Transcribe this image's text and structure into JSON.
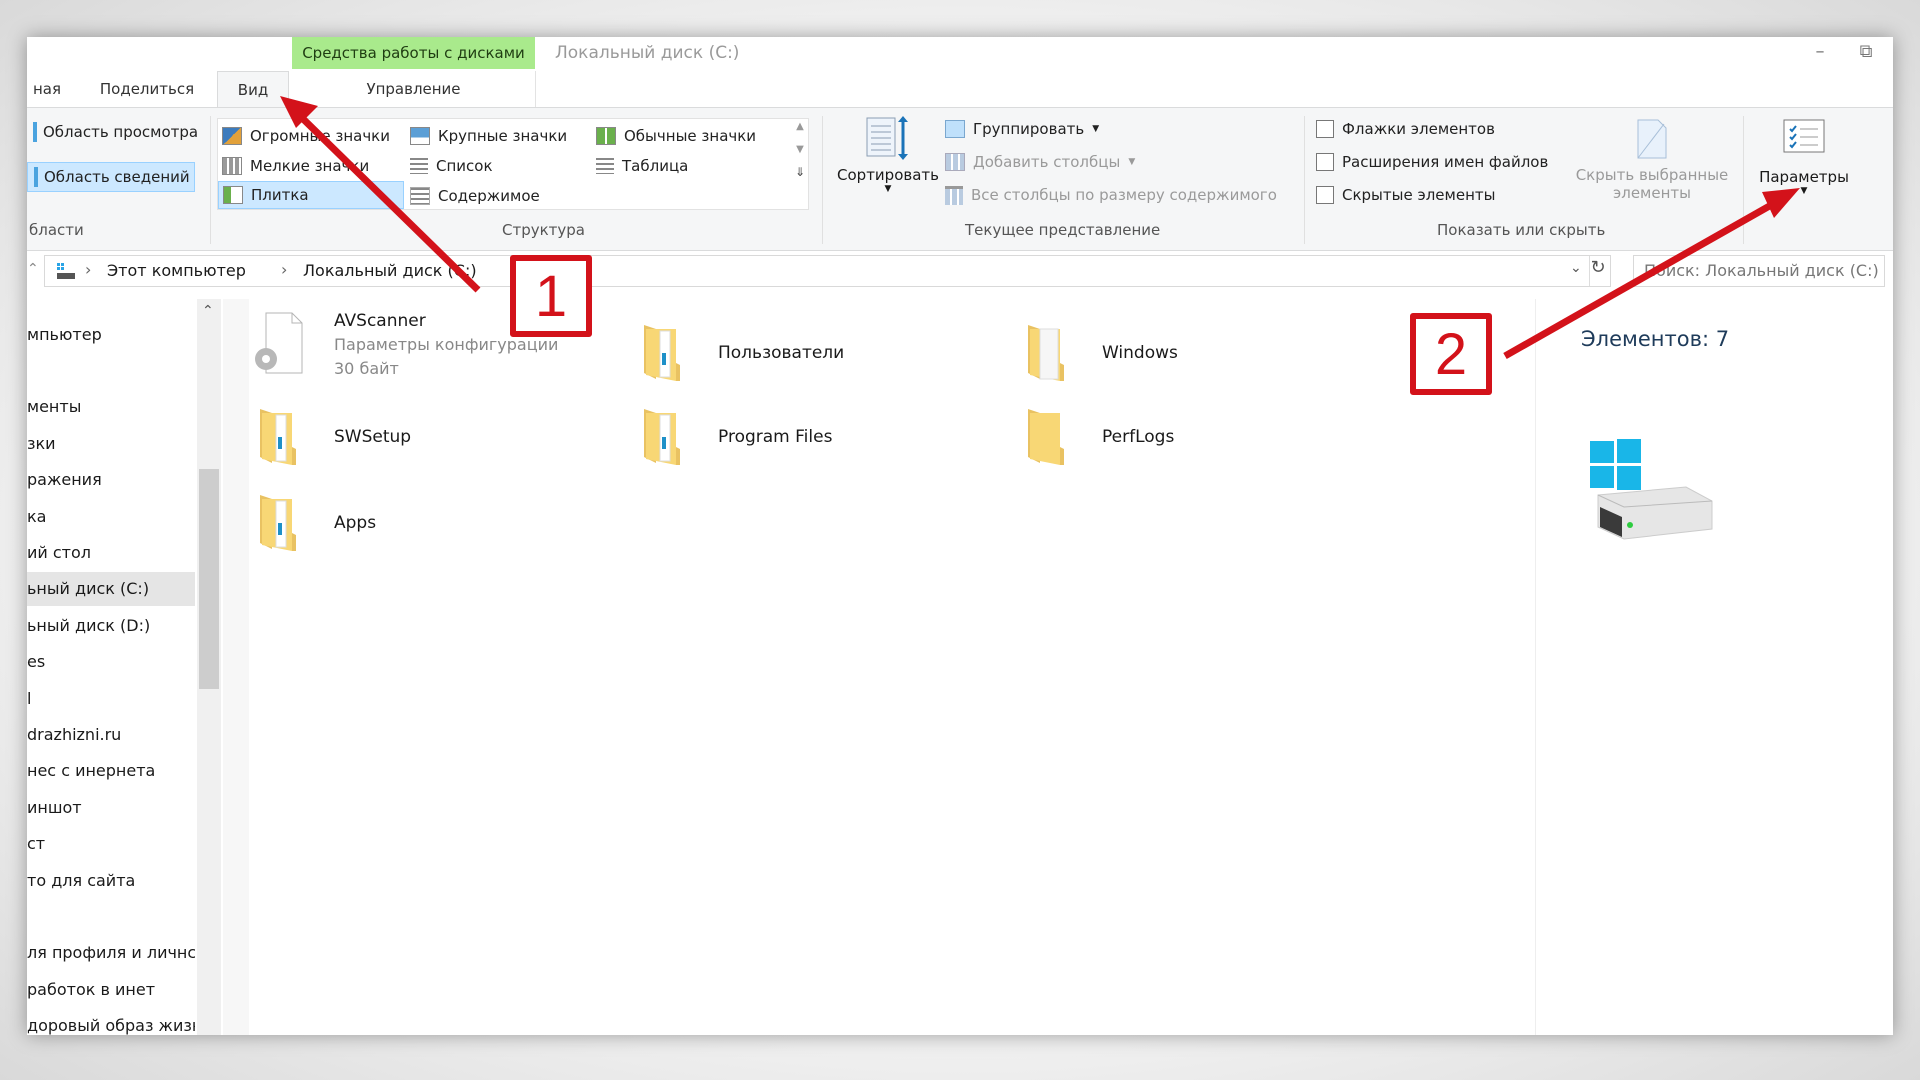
{
  "window": {
    "context_tab": "Средства работы с дисками",
    "title": "Локальный диск (C:)",
    "minimize_icon": "minimize-icon",
    "restore_icon": "restore-icon"
  },
  "tabs": [
    {
      "label": "ная",
      "active": false
    },
    {
      "label": "Поделиться",
      "active": false
    },
    {
      "label": "Вид",
      "active": true
    },
    {
      "label": "Управление",
      "active": false
    }
  ],
  "ribbon": {
    "panes": {
      "label": "бласти",
      "preview_pane": "Область просмотра",
      "details_pane": "Область сведений"
    },
    "layout": {
      "label": "Структура",
      "items": [
        "Огромные значки",
        "Крупные значки",
        "Обычные значки",
        "Мелкие значки",
        "Список",
        "Таблица",
        "Плитка",
        "Содержимое"
      ],
      "selected": "Плитка"
    },
    "current_view": {
      "label": "Текущее представление",
      "sort": "Сортировать",
      "group": "Группировать",
      "add_columns": "Добавить столбцы",
      "fit_columns": "Все столбцы по размеру содержимого"
    },
    "show_hide": {
      "label": "Показать или скрыть",
      "checkboxes": [
        {
          "label": "Флажки элементов",
          "checked": false
        },
        {
          "label": "Расширения имен файлов",
          "checked": false
        },
        {
          "label": "Скрытые элементы",
          "checked": false
        }
      ],
      "hide_selected": "Скрыть выбранные элементы",
      "hide_selected_line1": "Скрыть выбранные",
      "hide_selected_line2": "элементы"
    },
    "options": "Параметры"
  },
  "address": {
    "breadcrumb": [
      "Этот компьютер",
      "Локальный диск (C:)"
    ],
    "search_placeholder": "Поиск: Локальный диск (C:)"
  },
  "nav": {
    "items": [
      {
        "label": "мпьютер"
      },
      {
        "label": ""
      },
      {
        "label": "менты"
      },
      {
        "label": "зки"
      },
      {
        "label": "ражения"
      },
      {
        "label": "ка"
      },
      {
        "label": "ий стол"
      },
      {
        "label": "ьный диск (C:)",
        "selected": true
      },
      {
        "label": "ьный диск (D:)"
      },
      {
        "label": "es"
      },
      {
        "label": "l"
      },
      {
        "label": "drazhizni.ru"
      },
      {
        "label": "нес с инернета"
      },
      {
        "label": "иншот"
      },
      {
        "label": "ст"
      },
      {
        "label": "то для сайта"
      },
      {
        "label": ""
      },
      {
        "label": "ля профиля и личнс"
      },
      {
        "label": "работок в инет"
      },
      {
        "label": "доровый образ жизн"
      }
    ]
  },
  "files": [
    {
      "name": "AVScanner",
      "type": "Параметры конфигурации",
      "size": "30 байт",
      "icon": "config-file-icon"
    },
    {
      "name": "Пользователи",
      "icon": "folder-icon"
    },
    {
      "name": "Windows",
      "icon": "folder-icon"
    },
    {
      "name": "SWSetup",
      "icon": "folder-icon"
    },
    {
      "name": "Program Files",
      "icon": "folder-icon"
    },
    {
      "name": "PerfLogs",
      "icon": "folder-icon"
    },
    {
      "name": "Apps",
      "icon": "folder-icon"
    }
  ],
  "details": {
    "count_text": "Элементов: 7",
    "icon": "windows-drive-icon"
  },
  "annotations": [
    {
      "number": "1",
      "target": "Вид"
    },
    {
      "number": "2",
      "target": "Параметры"
    }
  ],
  "colors": {
    "context_tab": "#a9ea8c",
    "selection": "#cce8ff",
    "annotation_red": "#d3121a",
    "folder_yellow": "#f8d775"
  }
}
